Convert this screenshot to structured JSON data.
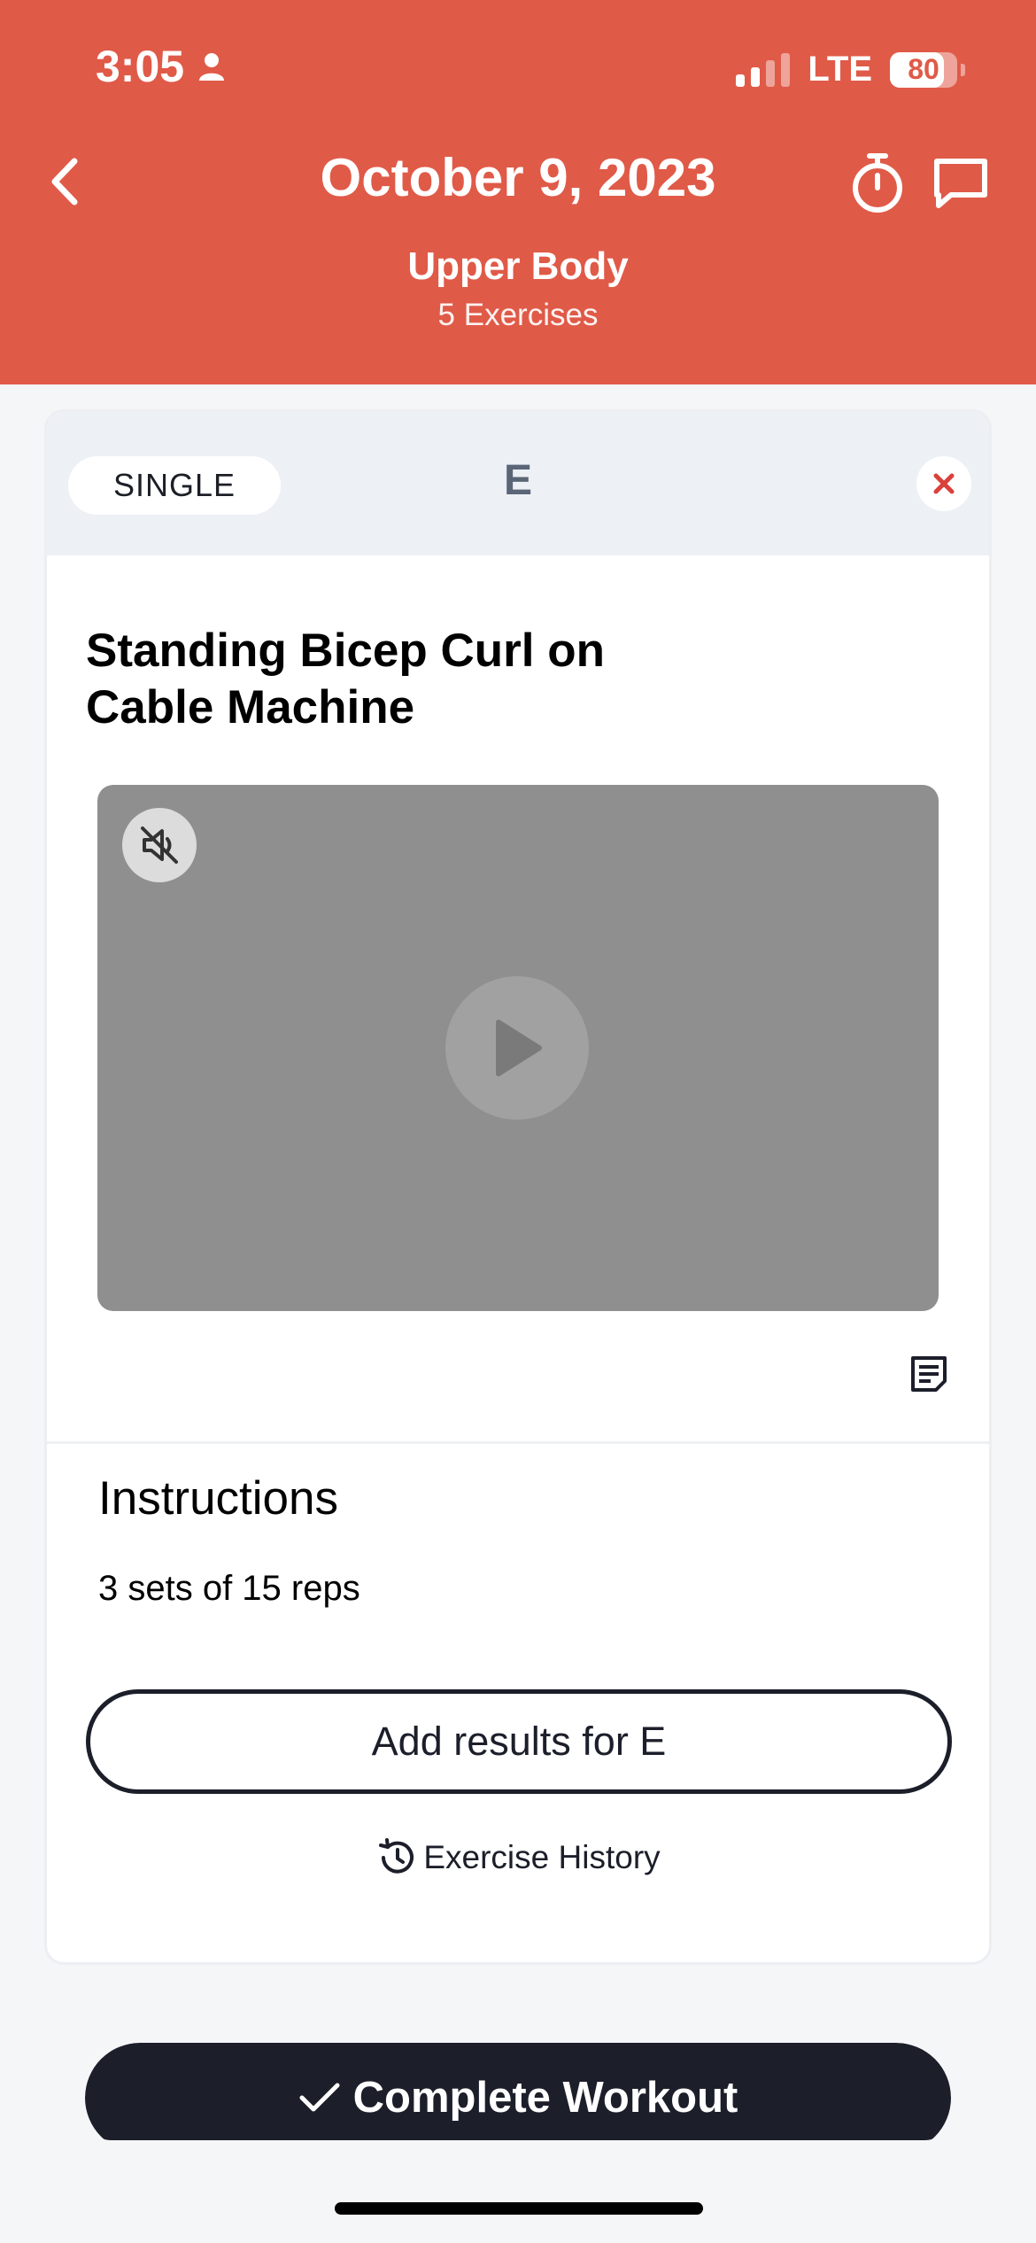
{
  "status_bar": {
    "time": "3:05",
    "network": "LTE",
    "battery": "80",
    "battery_level": 0.8,
    "signal_bars_filled": 2,
    "signal_bars_total": 4
  },
  "header": {
    "date": "October 9, 2023",
    "workout_name": "Upper Body",
    "exercise_count": "5 Exercises",
    "bg_color": "#e05a48"
  },
  "exercise_card": {
    "type_label": "SINGLE",
    "letter": "E",
    "name_line1": "Standing Bicep Curl on",
    "name_line2": "Cable Machine",
    "instructions_title": "Instructions",
    "instructions_text": "3 sets of 15 reps",
    "add_results_label": "Add results for E",
    "history_label": "Exercise History"
  },
  "footer": {
    "complete_label": "Complete Workout"
  },
  "icons": [
    "back-chevron-icon",
    "stopwatch-icon",
    "chat-bubble-icon",
    "close-x-icon",
    "mute-icon",
    "play-icon",
    "notes-icon",
    "history-icon",
    "checkmark-icon",
    "person-icon"
  ]
}
